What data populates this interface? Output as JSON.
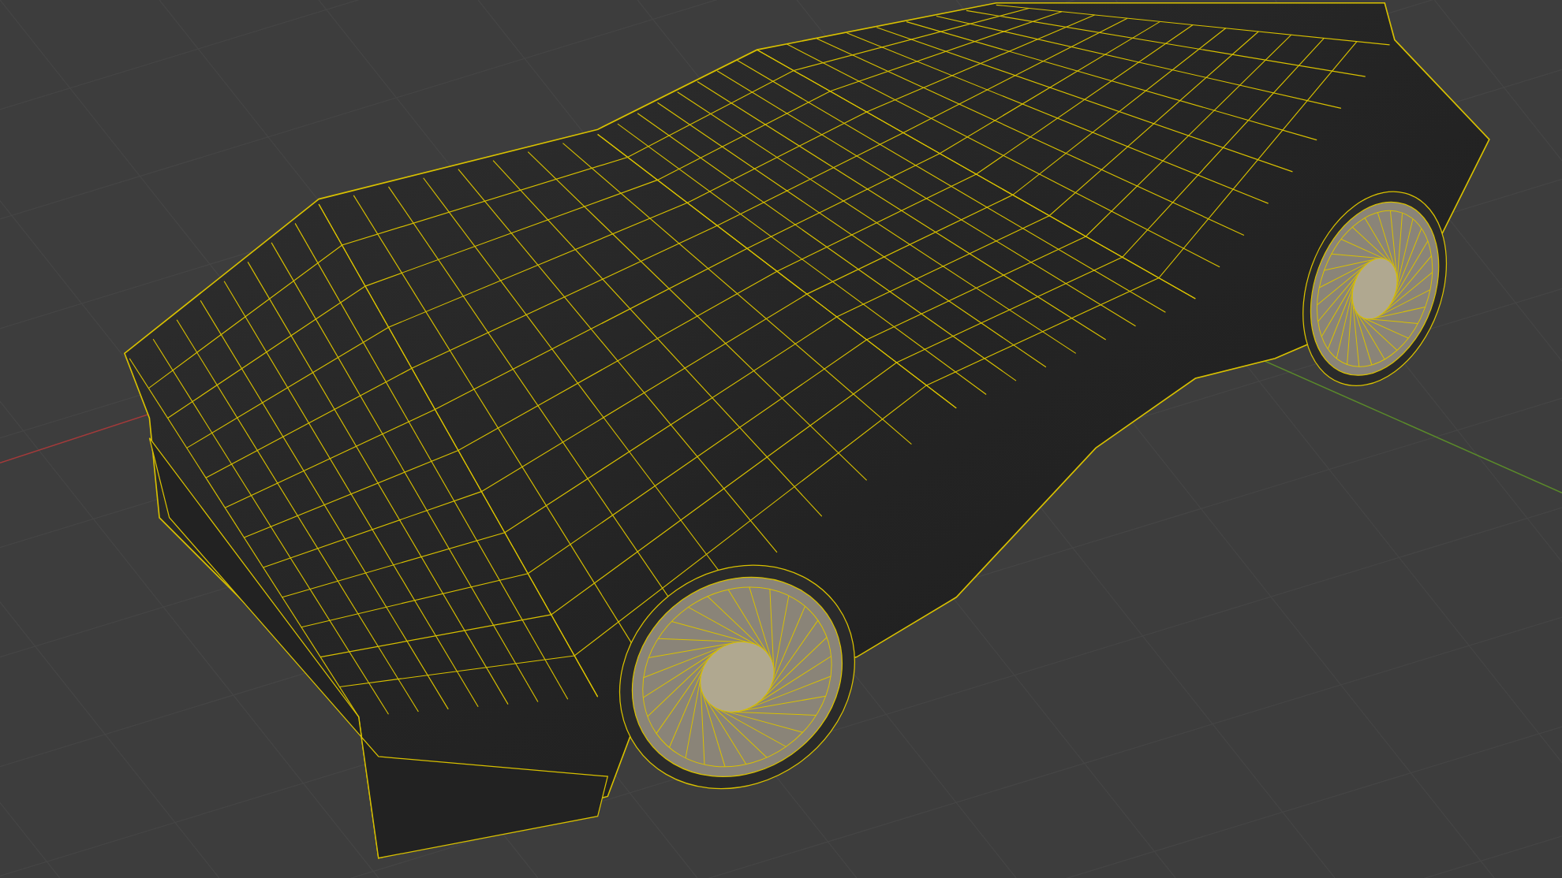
{
  "viewport": {
    "object_selected": true
  }
}
